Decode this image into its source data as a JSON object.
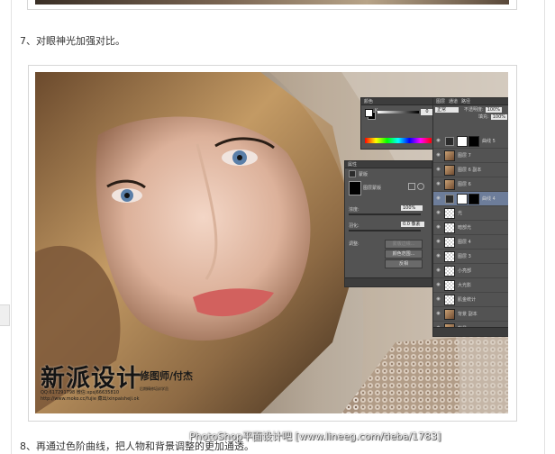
{
  "captions": {
    "step7": "7、对眼神光加强对比。",
    "step8": "8、再通过色阶曲线，把人物和背景调整的更加通透。"
  },
  "swatch_panel": {
    "tabs": [
      "颜色"
    ],
    "k_label": "K",
    "k_value": "0"
  },
  "layers_panel": {
    "tabs": [
      "图层",
      "通道",
      "路径"
    ],
    "blend_mode": "正常",
    "opacity_label": "不透明度:",
    "opacity_value": "100%",
    "fill_label": "填充:",
    "fill_value": "100%",
    "layers": [
      {
        "name": "曲线 5",
        "thumb": "adj",
        "mask": true,
        "selected": false
      },
      {
        "name": "图层 7",
        "thumb": "photo",
        "mask": false,
        "selected": false
      },
      {
        "name": "图层 6 副本",
        "thumb": "photo",
        "mask": false,
        "selected": false
      },
      {
        "name": "图层 6",
        "thumb": "photo",
        "mask": false,
        "selected": false
      },
      {
        "name": "曲线 4",
        "thumb": "adj",
        "mask": true,
        "selected": true
      },
      {
        "name": "光",
        "thumb": "checker",
        "mask": false,
        "selected": false
      },
      {
        "name": "暗部光",
        "thumb": "checker",
        "mask": false,
        "selected": false
      },
      {
        "name": "图层 4",
        "thumb": "checker",
        "mask": false,
        "selected": false
      },
      {
        "name": "图层 3",
        "thumb": "checker",
        "mask": false,
        "selected": false
      },
      {
        "name": "小亮部",
        "thumb": "checker",
        "mask": false,
        "selected": false
      },
      {
        "name": "大光影",
        "thumb": "checker",
        "mask": false,
        "selected": false
      },
      {
        "name": "肌金统计",
        "thumb": "checker",
        "mask": false,
        "selected": false
      },
      {
        "name": "背景 副本",
        "thumb": "photo",
        "mask": false,
        "selected": false
      },
      {
        "name": "背景",
        "thumb": "photo",
        "mask": false,
        "selected": false
      }
    ]
  },
  "properties_panel": {
    "title": "属性",
    "subtitle": "蒙版",
    "mask_label": "图层蒙版",
    "density_label": "浓度:",
    "density_value": "100%",
    "feather_label": "羽化:",
    "feather_value": "0.0 像素",
    "adjust_label": "调整:",
    "btn_mask_edge": "蒙版边缘...",
    "btn_color_range": "颜色范围...",
    "btn_invert": "反相"
  },
  "watermark": {
    "logo": "新派设计",
    "credit": "修图师/付杰",
    "phone": "QQ:617291798 微信:xpsj66635810",
    "site": "http://www.moko.cc/fujie 藏出/xinpaisheji.ok",
    "note": "后期精修培训学员"
  },
  "site_watermark": "PhotoShop平面设计吧 [www.lineeg.com/tieba/1783]",
  "colors": {
    "panel_bg": "#535353",
    "panel_dark": "#3d3d3d",
    "selected_layer": "#6d7d9a"
  }
}
